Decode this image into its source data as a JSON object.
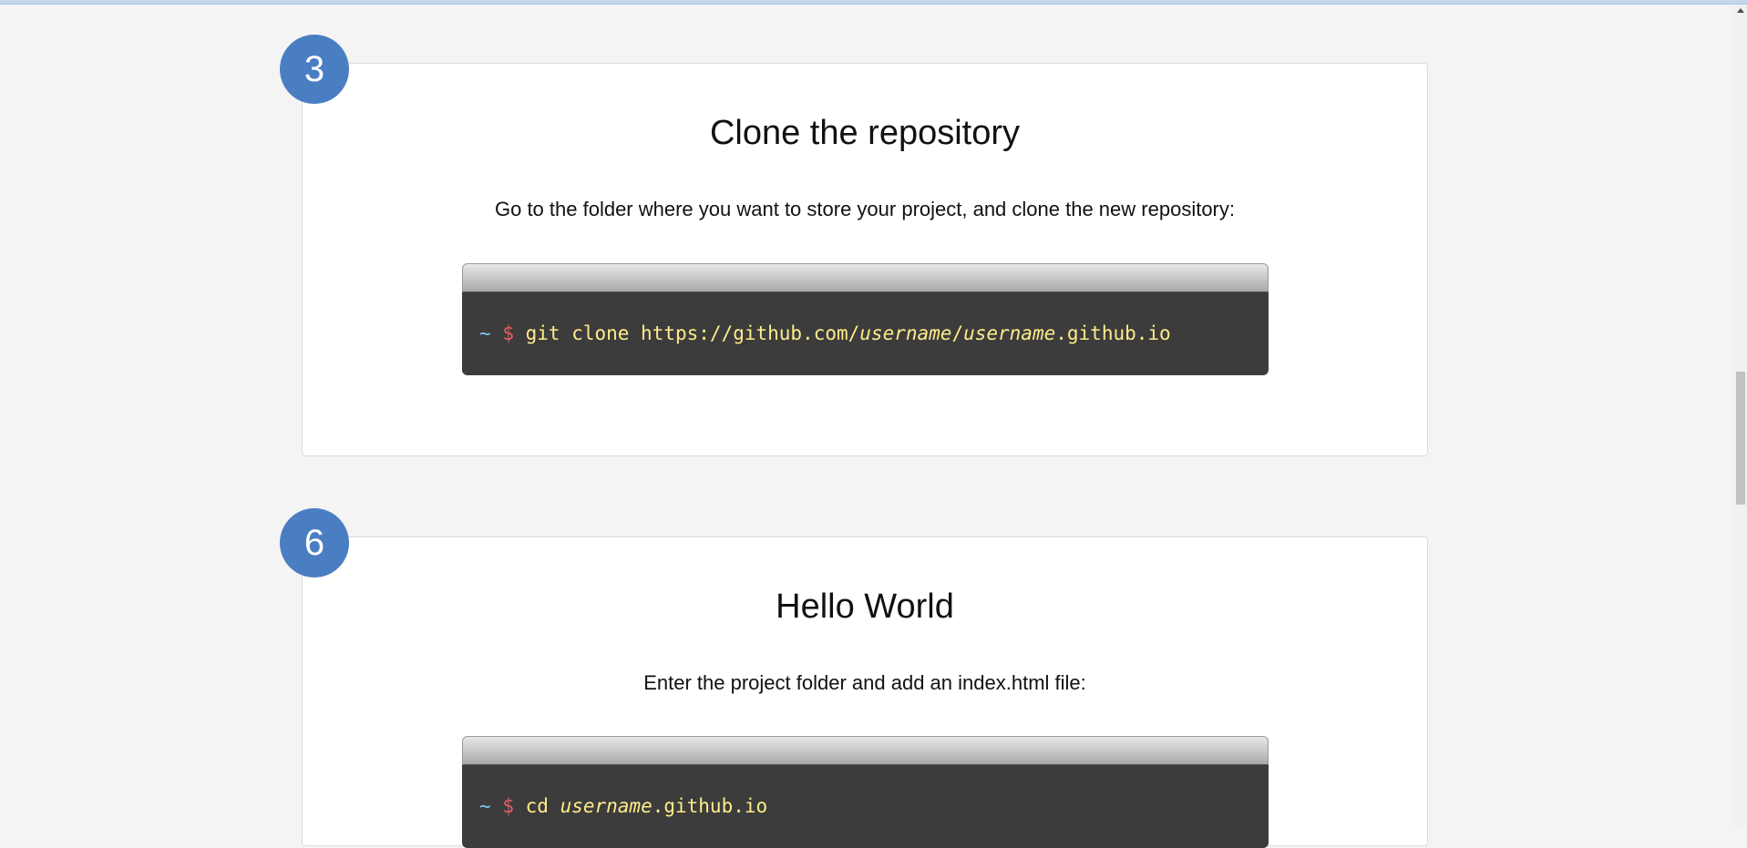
{
  "steps": [
    {
      "number": "3",
      "title": "Clone the repository",
      "description": "Go to the folder where you want to store your project, and clone the new repository:",
      "terminal": {
        "prompt_tilde": "~",
        "prompt_dollar": "$",
        "command_parts": [
          {
            "text": "git clone https://github.com/",
            "italic": false
          },
          {
            "text": "username",
            "italic": true
          },
          {
            "text": "/",
            "italic": false
          },
          {
            "text": "username",
            "italic": true
          },
          {
            "text": ".github.io",
            "italic": false
          }
        ]
      }
    },
    {
      "number": "6",
      "title": "Hello World",
      "description": "Enter the project folder and add an index.html file:",
      "terminal": {
        "prompt_tilde": "~",
        "prompt_dollar": "$",
        "command_parts": [
          {
            "text": "cd ",
            "italic": false
          },
          {
            "text": "username",
            "italic": true
          },
          {
            "text": ".github.io",
            "italic": false
          }
        ]
      }
    }
  ],
  "colors": {
    "badge": "#4a7ec2",
    "terminal_bg": "#3c3c3c",
    "command_text": "#ffec8b",
    "prompt_tilde": "#7ec8ee",
    "prompt_dollar": "#e65e5e",
    "page_bg": "#f4f4f4"
  }
}
